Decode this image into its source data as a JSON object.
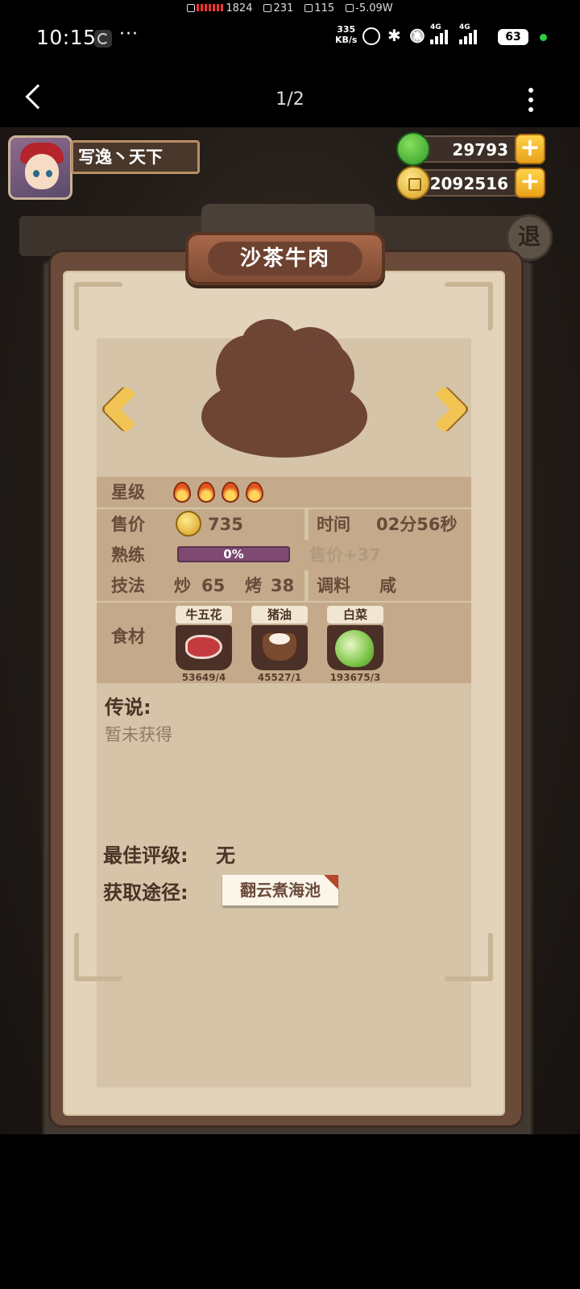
{
  "debug": {
    "cpu": "1824",
    "mem": "231",
    "fps": "115",
    "power": "-5.09W"
  },
  "status": {
    "time": "10:15",
    "dots": "···",
    "speed_value": "335",
    "speed_unit": "KB/s",
    "network": "4G",
    "battery": "63"
  },
  "nav": {
    "page_indicator": "1/2"
  },
  "player": {
    "name": "写逸丶天下"
  },
  "currency": {
    "jade": "29793",
    "coins": "2092516",
    "plus": "+"
  },
  "exit_label": "退",
  "dish": {
    "name": "沙茶牛肉",
    "star_label": "星级",
    "star_count": 4,
    "price_label": "售价",
    "price": "735",
    "time_label": "时间",
    "time": "02分56秒",
    "mastery_label": "熟练",
    "mastery": "0%",
    "mastery_fraction": 0.0,
    "mastery_bonus": "售价+37",
    "skill_label": "技法",
    "skill1_name": "炒",
    "skill1_value": "65",
    "skill2_name": "烤",
    "skill2_value": "38",
    "seasoning_label": "调料",
    "seasoning": "咸",
    "ingredients_label": "食材",
    "ingredients": [
      {
        "name": "牛五花",
        "count": "53649/4",
        "icon": "pork-belly-icon"
      },
      {
        "name": "猪油",
        "count": "45527/1",
        "icon": "lard-icon"
      },
      {
        "name": "白菜",
        "count": "193675/3",
        "icon": "cabbage-icon"
      }
    ],
    "legend_label": "传说:",
    "legend_value": "暂未获得",
    "best_rating_label": "最佳评级:",
    "best_rating": "无",
    "source_label": "获取途径:",
    "source": "翻云煮海池"
  },
  "colors": {
    "panel": "#6a4b3a",
    "paper": "#e3d3bb",
    "row": "#c4aa8a",
    "text": "#6a4a3a",
    "gold": "#f2c453",
    "progress": "#7e4a72"
  }
}
